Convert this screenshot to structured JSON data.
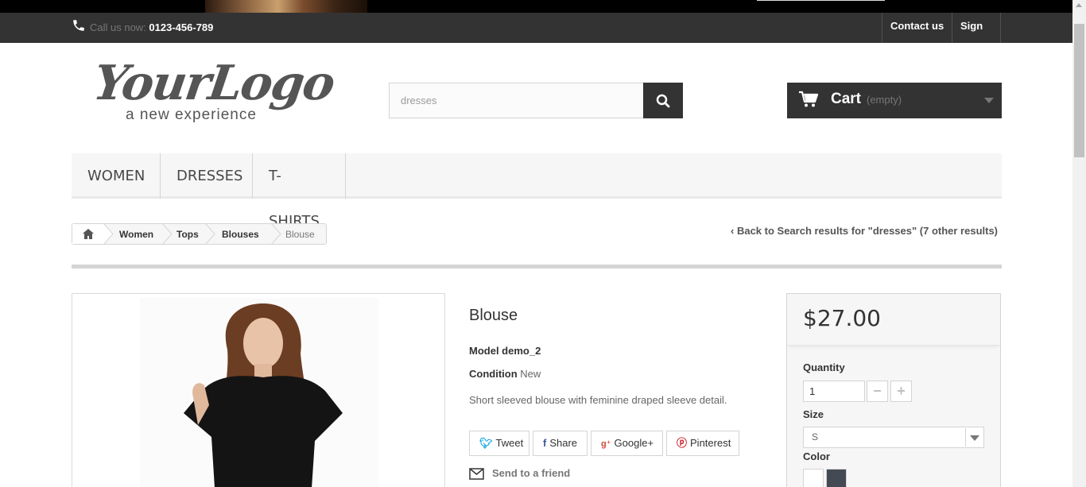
{
  "header": {
    "call_label": "Call us now: ",
    "phone": "0123-456-789",
    "contact_label": "Contact us",
    "signin_label": "Sign in"
  },
  "logo": {
    "main": "YourLogo",
    "tagline": "a new experience"
  },
  "search": {
    "value": "dresses",
    "icon": "search-icon"
  },
  "cart": {
    "label": "Cart",
    "status": "(empty)"
  },
  "menu": {
    "items": [
      "Women",
      "Dresses",
      "T-shirts"
    ]
  },
  "breadcrumb": {
    "items": [
      "Women",
      "Tops",
      "Blouses",
      "Blouse"
    ]
  },
  "back_link": "Back to Search results for \"dresses\" (7 other results)",
  "product": {
    "title": "Blouse",
    "model_text": "Model demo_2",
    "condition_label": "Condition",
    "condition_value": "New",
    "description": "Short sleeved blouse with feminine draped sleeve detail.",
    "share": {
      "tweet": "Tweet",
      "share": "Share",
      "google": "Google+",
      "pinterest": "Pinterest"
    },
    "send_friend": "Send to a friend"
  },
  "buy": {
    "price": "$27.00",
    "quantity_label": "Quantity",
    "quantity_value": "1",
    "size_label": "Size",
    "size_value": "S",
    "color_label": "Color",
    "colors": [
      "#ffffff",
      "#434a54"
    ]
  }
}
